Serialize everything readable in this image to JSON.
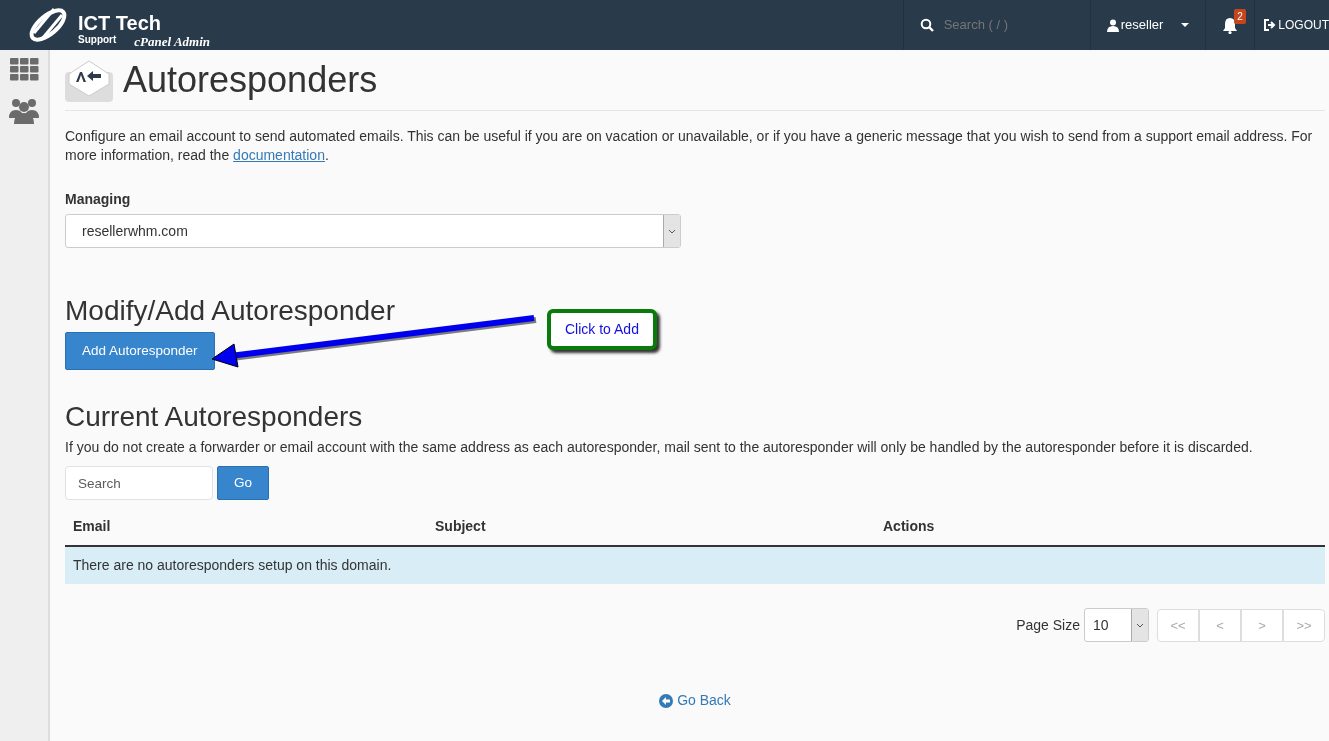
{
  "brand": {
    "name": "ICT Tech",
    "sub": "Support",
    "product": "cPanel Admin"
  },
  "topbar": {
    "search_placeholder": "Search ( / )",
    "user": "reseller",
    "notifications": "2",
    "logout": "LOGOUT"
  },
  "page": {
    "title": "Autoresponders",
    "intro": "Configure an email account to send automated emails. This can be useful if you are on vacation or unavailable, or if you have a generic message that you wish to send from a support email address. For more information, read the ",
    "intro_link": "documentation",
    "intro_end": "."
  },
  "managing": {
    "label": "Managing",
    "value": "resellerwhm.com"
  },
  "modify": {
    "heading": "Modify/Add Autoresponder",
    "button": "Add Autoresponder"
  },
  "annotation": {
    "text": "Click to Add"
  },
  "current": {
    "heading": "Current Autoresponders",
    "note": "If you do not create a forwarder or email account with the same address as each autoresponder, mail sent to the autoresponder will only be handled by the autoresponder before it is discarded.",
    "search_placeholder": "Search",
    "go": "Go"
  },
  "table": {
    "columns": [
      "Email",
      "Subject",
      "Actions"
    ],
    "empty": "There are no autoresponders setup on this domain."
  },
  "pager": {
    "label": "Page Size",
    "size": "10",
    "buttons": [
      {
        "label": "<<",
        "disabled": true
      },
      {
        "label": "<",
        "disabled": true
      },
      {
        "label": ">",
        "disabled": true
      },
      {
        "label": ">>",
        "disabled": true
      }
    ]
  },
  "go_back": "Go Back"
}
